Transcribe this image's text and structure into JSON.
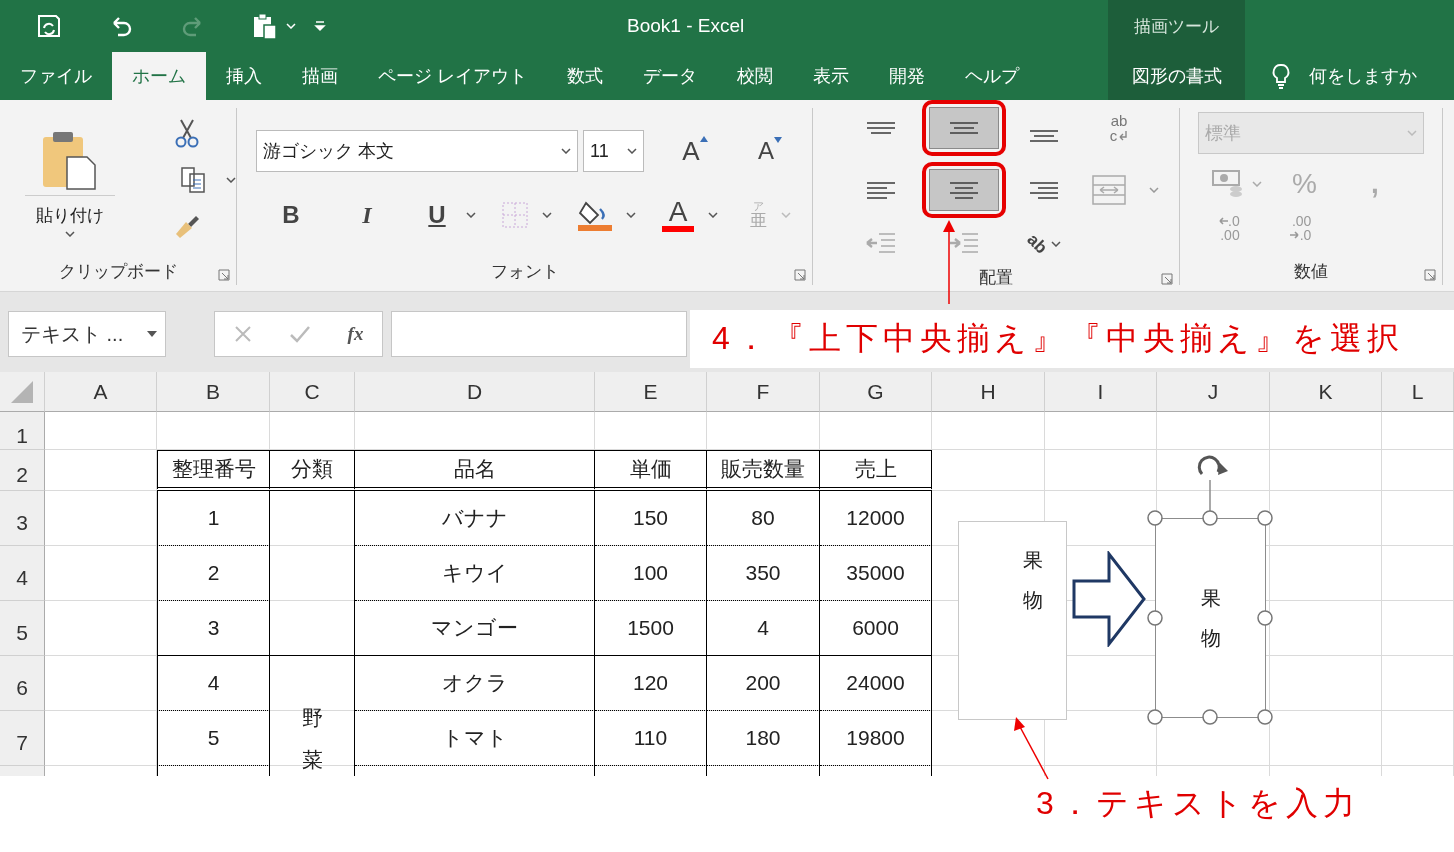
{
  "window": {
    "title": "Book1  -  Excel"
  },
  "context_group": {
    "title": "描画ツール",
    "tabs": [
      {
        "label": "図形の書式",
        "selected": false
      }
    ]
  },
  "tabs": [
    {
      "label": "ファイル",
      "selected": false
    },
    {
      "label": "ホーム",
      "selected": true
    },
    {
      "label": "挿入",
      "selected": false
    },
    {
      "label": "描画",
      "selected": false
    },
    {
      "label": "ページ レイアウト",
      "selected": false
    },
    {
      "label": "数式",
      "selected": false
    },
    {
      "label": "データ",
      "selected": false
    },
    {
      "label": "校閲",
      "selected": false
    },
    {
      "label": "表示",
      "selected": false
    },
    {
      "label": "開発",
      "selected": false
    },
    {
      "label": "ヘルプ",
      "selected": false
    }
  ],
  "tell_me": {
    "text": "何をしますか"
  },
  "ribbon": {
    "clipboard": {
      "paste": "貼り付け",
      "label": "クリップボード"
    },
    "font": {
      "font_name": "游ゴシック 本文",
      "font_size": "11",
      "grow": "A",
      "shrink": "A",
      "bold": "B",
      "italic": "I",
      "underline": "U",
      "font_color": "A",
      "phonetic_ruby": "ア",
      "phonetic_base": "亜",
      "label": "フォント"
    },
    "alignment": {
      "buttons": [
        {
          "kind": "top",
          "selected": false,
          "highlighted": false
        },
        {
          "kind": "middle",
          "selected": true,
          "highlighted": true
        },
        {
          "kind": "bottom",
          "selected": false,
          "highlighted": false
        },
        {
          "kind": "wrap",
          "label": "ab",
          "label2": "c",
          "selected": false,
          "highlighted": false
        },
        {
          "kind": "left",
          "selected": false,
          "highlighted": false
        },
        {
          "kind": "center",
          "selected": true,
          "highlighted": true
        },
        {
          "kind": "right",
          "selected": false,
          "highlighted": false
        },
        {
          "kind": "merge",
          "selected": false,
          "highlighted": false
        },
        {
          "kind": "outdent",
          "selected": false,
          "highlighted": false
        },
        {
          "kind": "indent",
          "selected": false,
          "highlighted": false
        },
        {
          "kind": "orientation",
          "label": "ab",
          "selected": false,
          "highlighted": false
        }
      ],
      "label": "配置"
    },
    "number": {
      "format": {
        "value": "標準",
        "disabled": true
      },
      "percent": "%",
      "comma": ",",
      "increase_decimal": [
        ".0",
        ".00"
      ],
      "decrease_decimal": [
        ".00",
        ".0"
      ],
      "label": "数値"
    }
  },
  "formula_bar": {
    "name_box": "テキスト ...",
    "fx": "fx"
  },
  "sheet": {
    "columns": [
      "A",
      "B",
      "C",
      "D",
      "E",
      "F",
      "G",
      "H",
      "I",
      "J",
      "K",
      "L"
    ],
    "rows": [
      "1",
      "2",
      "3",
      "4",
      "5",
      "6",
      "7"
    ],
    "table": {
      "header": [
        "整理番号",
        "分類",
        "品名",
        "単価",
        "販売数量",
        "売上"
      ],
      "groups": [
        {
          "rows": [
            {
              "cells": [
                "1",
                "バナナ",
                "150",
                "80",
                "12000"
              ]
            },
            {
              "cells": [
                "2",
                "キウイ",
                "100",
                "350",
                "35000"
              ]
            },
            {
              "cells": [
                "3",
                "マンゴー",
                "1500",
                "4",
                "6000"
              ]
            }
          ]
        },
        {
          "label": "野菜",
          "rows": [
            {
              "cells": [
                "4",
                "オクラ",
                "120",
                "200",
                "24000"
              ]
            },
            {
              "cells": [
                "5",
                "トマト",
                "110",
                "180",
                "19800"
              ]
            }
          ]
        }
      ]
    }
  },
  "shapes": [
    {
      "kind": "textbox",
      "text": "果物",
      "selected": false
    },
    {
      "kind": "arrow",
      "selected": false
    },
    {
      "kind": "textbox",
      "text": "果物",
      "selected": true
    }
  ],
  "annotations": [
    {
      "text": "4．『上下中央揃え』『中央揃え』を選択"
    },
    {
      "text": "3．テキストを入力"
    }
  ]
}
